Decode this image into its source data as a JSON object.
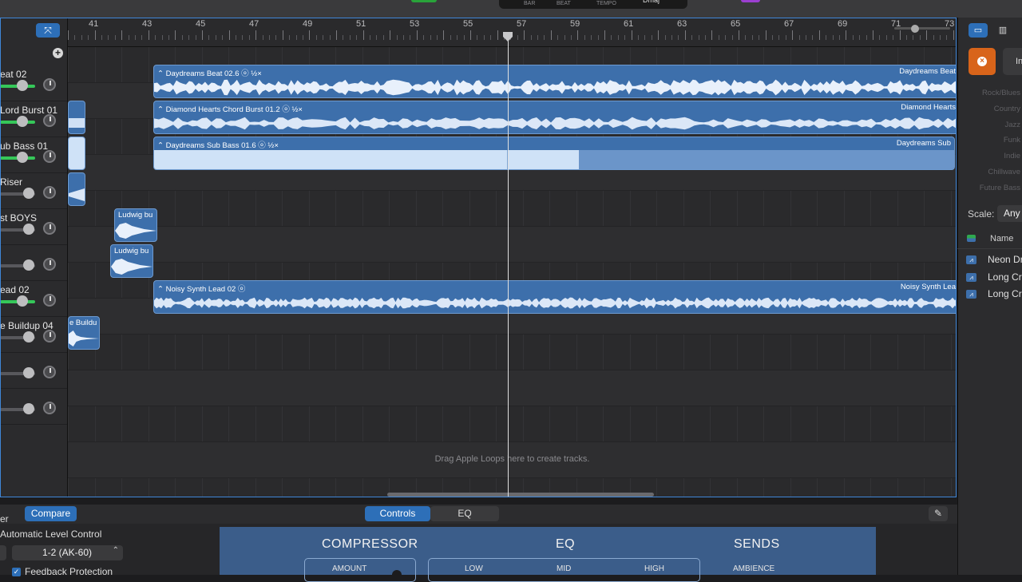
{
  "lcd": {
    "bar": "BAR",
    "beat": "BEAT",
    "tempo": "TEMPO",
    "key": "Dmaj"
  },
  "ruler": {
    "bars": [
      "41",
      "43",
      "45",
      "47",
      "49",
      "51",
      "53",
      "55",
      "57",
      "59",
      "61",
      "63",
      "65",
      "67",
      "69",
      "71",
      "73"
    ]
  },
  "tracks": [
    {
      "name": "eat 02",
      "volume_on": true
    },
    {
      "name": "Lord Burst 01",
      "volume_on": true
    },
    {
      "name": "ub Bass 01",
      "volume_on": true
    },
    {
      "name": " Riser",
      "volume_on": false
    },
    {
      "name": "st BOYS",
      "volume_on": false
    },
    {
      "name": "",
      "volume_on": false
    },
    {
      "name": "ead 02",
      "volume_on": true
    },
    {
      "name": "e Buildup 04",
      "volume_on": false
    },
    {
      "name": "",
      "volume_on": false
    },
    {
      "name": "",
      "volume_on": false
    }
  ],
  "regions": {
    "beat": {
      "label": "Daydreams Beat 02.6",
      "loop": "½×",
      "label_right": "Daydreams Beat"
    },
    "chord": {
      "label": "Diamond Hearts Chord Burst 01.2",
      "loop": "½×",
      "label_right": "Diamond Hearts"
    },
    "sub": {
      "label": "Daydreams Sub Bass 01.6",
      "loop": "½×",
      "label_right": "Daydreams Sub"
    },
    "ludwig1": {
      "label": "Ludwig bu"
    },
    "ludwig2": {
      "label": "Ludwig bu"
    },
    "lead": {
      "label": "Noisy Synth Lead 02",
      "label_right": "Noisy Synth Lea"
    },
    "buildup": {
      "label": "e Buildu"
    }
  },
  "drag_hint": "Drag Apple Loops here to create tracks.",
  "right_panel": {
    "tab_partial": "In",
    "genres": [
      "Rock/Blues",
      "Country",
      "Jazz",
      "Funk",
      "Indie",
      "Chillwave",
      "Future Bass"
    ],
    "scale_label": "Scale:",
    "scale_value": "Any",
    "name_header": "Name",
    "loops": [
      "Neon Dr",
      "Long Cr",
      "Long Cr"
    ]
  },
  "bottom": {
    "left_partial": "er",
    "compare": "Compare",
    "controls_tab": "Controls",
    "eq_tab": "EQ",
    "alc": "Automatic Level Control",
    "input": "1-2  (AK-60)",
    "feedback": "Feedback Protection"
  },
  "plugin": {
    "compressor": "COMPRESSOR",
    "amount": "AMOUNT",
    "eq": "EQ",
    "low": "LOW",
    "mid": "MID",
    "high": "HIGH",
    "sends": "SENDS",
    "ambience": "AMBIENCE"
  },
  "colors": {
    "region": "#3d6fab",
    "accent": "#2d6fb8",
    "volume": "#35c759",
    "plugin": "#3b5d8a",
    "orange": "#d8641a"
  }
}
